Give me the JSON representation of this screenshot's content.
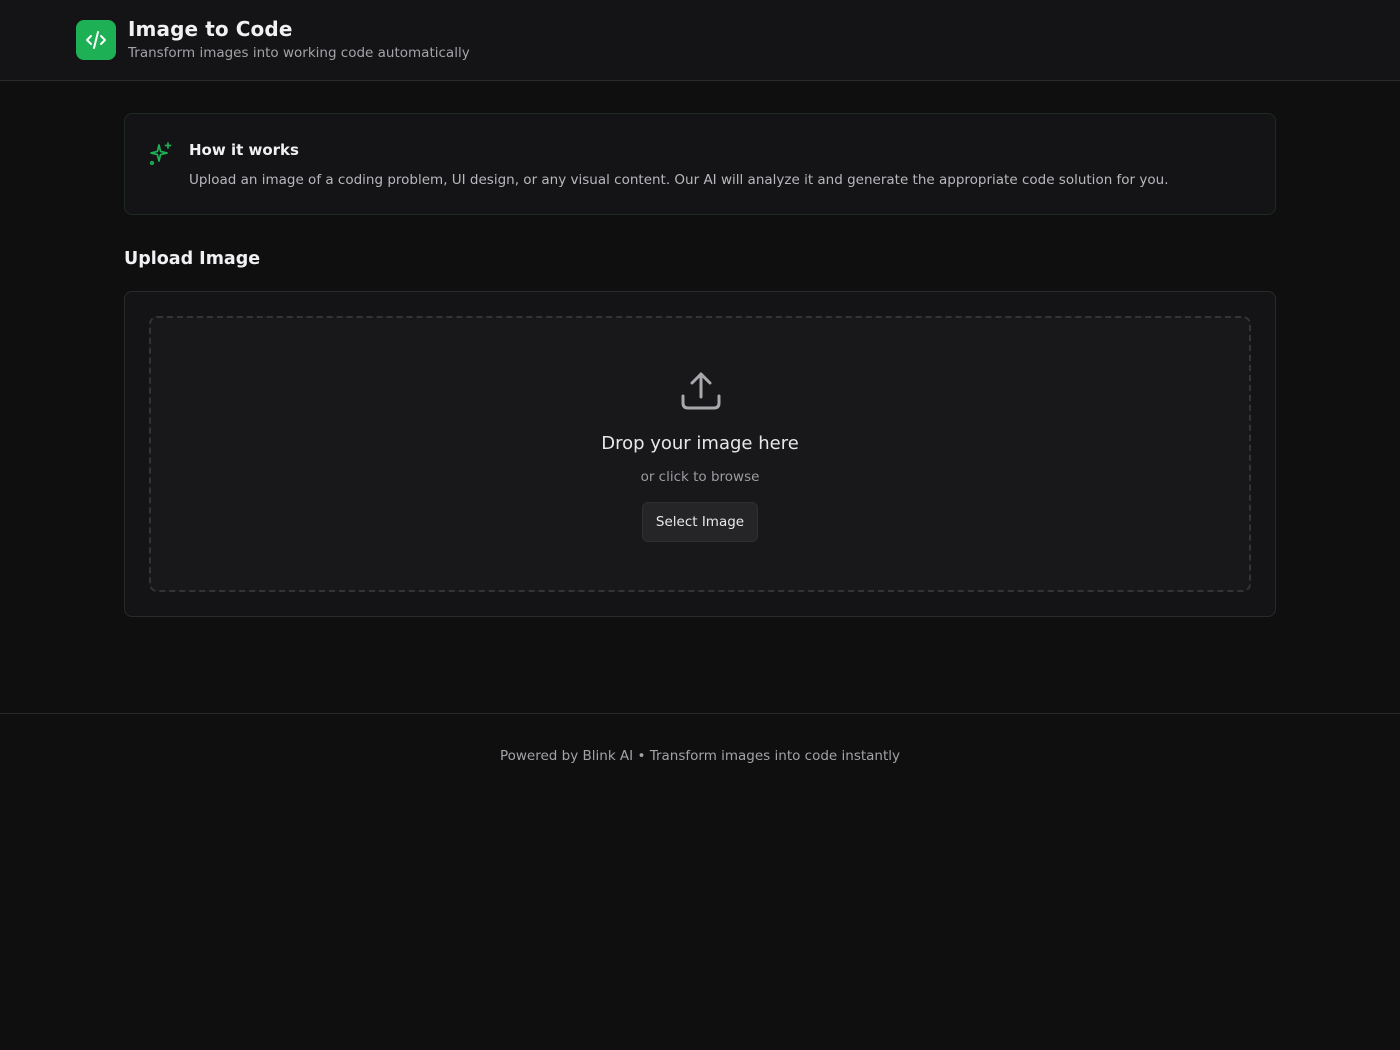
{
  "app": {
    "title": "Image to Code",
    "subtitle": "Transform images into working code automatically",
    "logo_icon": "code-icon",
    "accent_color": "#1db055"
  },
  "info": {
    "icon": "sparkles-icon",
    "title": "How it works",
    "text": "Upload an image of a coding problem, UI design, or any visual content. Our AI will analyze it and generate the appropriate code solution for you."
  },
  "upload": {
    "section_title": "Upload Image",
    "icon": "upload-icon",
    "drop_title": "Drop your image here",
    "drop_sub": "or click to browse",
    "button_label": "Select Image"
  },
  "footer": {
    "text": "Powered by Blink AI • Transform images into code instantly"
  }
}
